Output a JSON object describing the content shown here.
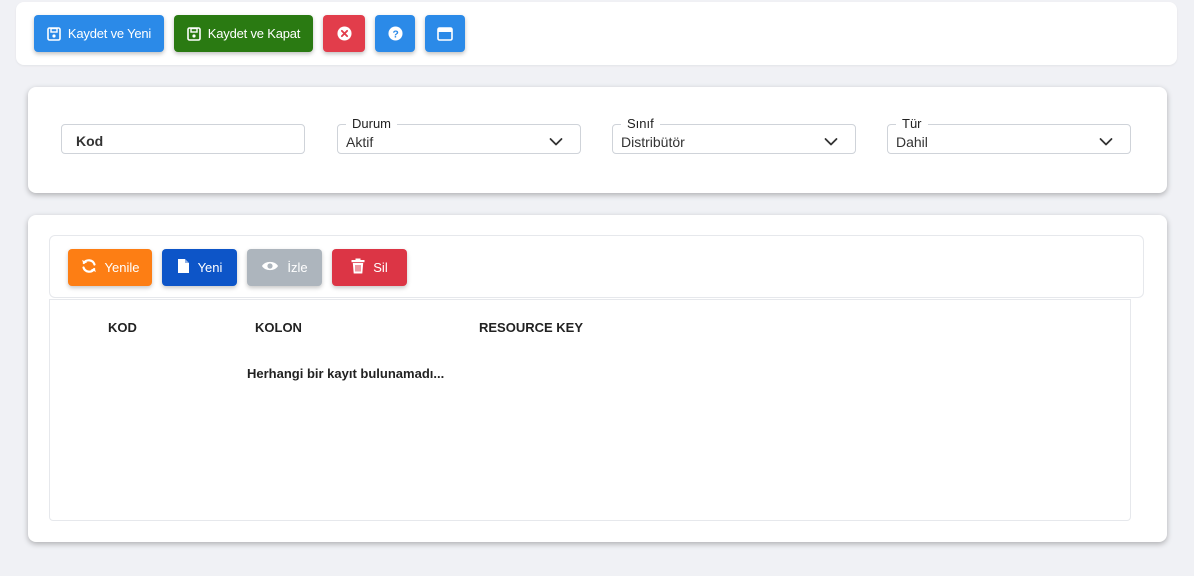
{
  "toolbar": {
    "save_new": "Kaydet ve Yeni",
    "save_close": "Kaydet ve Kapat",
    "cancel_icon": "close-circle-icon",
    "help_icon": "question-circle-icon",
    "window_icon": "window-icon"
  },
  "form": {
    "kod": {
      "placeholder": "Kod",
      "value": ""
    },
    "durum": {
      "label": "Durum",
      "value": "Aktif"
    },
    "sinif": {
      "label": "Sınıf",
      "value": "Distribütör"
    },
    "tur": {
      "label": "Tür",
      "value": "Dahil"
    }
  },
  "grid_toolbar": {
    "refresh": "Yenile",
    "new": "Yeni",
    "view": "İzle",
    "delete": "Sil"
  },
  "table": {
    "columns": [
      "KOD",
      "KOLON",
      "RESOURCE KEY"
    ],
    "rows": [],
    "empty_message": "Herhangi bir kayıt bulunamadı..."
  },
  "colors": {
    "primary": "#2b8ae8",
    "success": "#2a7a12",
    "danger": "#e23d4b",
    "warning": "#fd7e14",
    "navy": "#0d55c8",
    "disabled": "#adb5bd"
  }
}
